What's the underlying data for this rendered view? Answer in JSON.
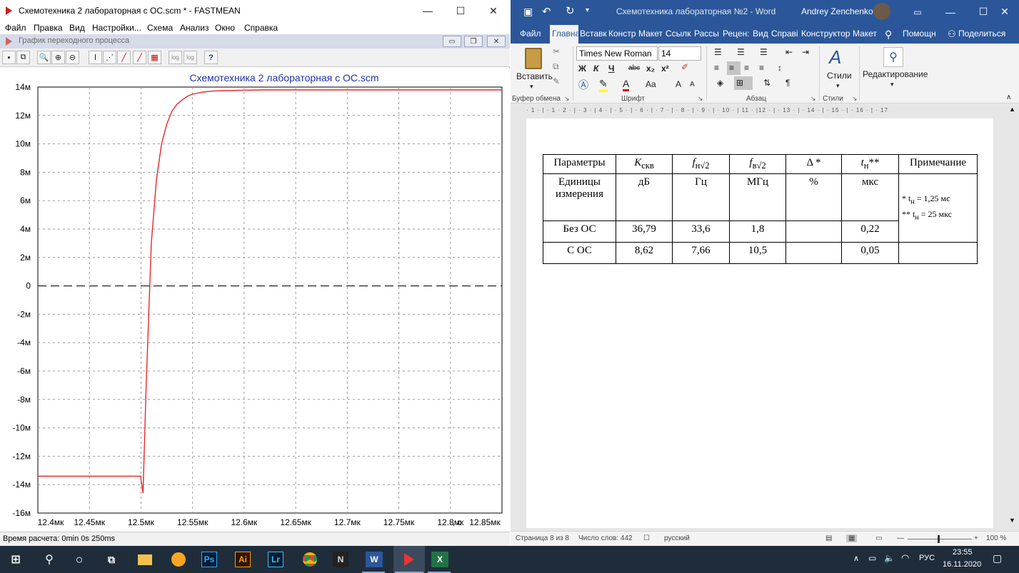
{
  "fastmean": {
    "title": "Схемотехника 2 лабораторная с OC.scm * - FASTMEAN",
    "menu": [
      "Файл",
      "Правка",
      "Вид",
      "Настройки...",
      "Схема",
      "Анализ",
      "Окно",
      "Справка"
    ],
    "child_title": "График переходного процесса",
    "toolbar_icons": [
      "save-icon",
      "copy-icon",
      "zoom-icon",
      "zoom-area-icon",
      "zoom-reset-icon",
      "text-cursor-icon",
      "dots-line-icon",
      "line-icon",
      "red-line-icon",
      "grid-icon",
      "log-x-icon",
      "log-y-icon",
      "help-icon"
    ],
    "log_label": "log",
    "help_label": "?",
    "status": "Время расчета: 0min 0s 250ms"
  },
  "chart_data": {
    "type": "line",
    "title": "Схемотехника 2 лабораторная с OC.scm",
    "xlabel": "с",
    "ylabel": "",
    "xlim": [
      12.4,
      12.85
    ],
    "ylim": [
      -16,
      14
    ],
    "x_ticks": [
      "12.4мк",
      "12.45мк",
      "12.5мк",
      "12.55мк",
      "12.6мк",
      "12.65мк",
      "12.7мк",
      "12.75мк",
      "12.8мк",
      "12.85мк"
    ],
    "y_ticks": [
      "14м",
      "12м",
      "10м",
      "8м",
      "6м",
      "4м",
      "2м",
      "0",
      "-2м",
      "-4м",
      "-6м",
      "-8м",
      "-10м",
      "-12м",
      "-14м",
      "-16м"
    ],
    "grid": true,
    "series": [
      {
        "color": "#e8282b",
        "x": [
          12.4,
          12.5,
          12.5,
          12.502,
          12.505,
          12.51,
          12.515,
          12.52,
          12.525,
          12.53,
          12.535,
          12.54,
          12.545,
          12.55,
          12.56,
          12.57,
          12.58,
          12.6,
          12.62,
          12.65,
          12.85
        ],
        "y": [
          -13.4,
          -13.4,
          -13.6,
          -14.6,
          -7.0,
          3.0,
          7.5,
          10.0,
          11.4,
          12.3,
          12.8,
          13.1,
          13.35,
          13.5,
          13.65,
          13.72,
          13.75,
          13.78,
          13.8,
          13.8,
          13.8
        ]
      }
    ],
    "zero_line": 0
  },
  "word": {
    "title": "Схемотехника лабораторная №2  -  Word",
    "user": "Andrey Zenchenko",
    "tabs": [
      "Файл",
      "Главна",
      "Вставк",
      "Констр",
      "Макет",
      "Ссылкі",
      "Рассы",
      "Рецен:",
      "Вид",
      "Справі",
      "Конструктор",
      "Макет"
    ],
    "help_label": "Помощн",
    "share_label": "Поделиться",
    "font_name": "Times New Roman",
    "font_size": "14",
    "paste_label": "Вставить",
    "styles_label": "Стили",
    "editing_label": "Редактирование",
    "groups": [
      "Буфер обмена",
      "Шрифт",
      "Абзац",
      "Стили"
    ],
    "font_buttons": [
      "Ж",
      "К",
      "Ч",
      "abc",
      "x₂",
      "x²",
      "A",
      "Aa",
      "A",
      "A"
    ],
    "ruler_text": "· 1 · | · 1 · 2 · | · 3 · | 4 · | · 5 · | · 6 · | · 7 · | · 8 · | · 9 · | · 10 · | 11 · |12 · | · 13 · | · 14 · | · 15 · | · 16 · | · 17",
    "table": {
      "headers": [
        "Параметры",
        "K",
        "скв",
        "f",
        "н√2",
        "f",
        "в√2",
        "Δ *",
        "t",
        "н",
        "**",
        "Примечание"
      ],
      "row_units": [
        "Единицы измерения",
        "дБ",
        "Гц",
        "МГц",
        "%",
        "мкс"
      ],
      "row_no_fb": [
        "Без ОС",
        "36,79",
        "33,6",
        "1,8",
        "",
        "0,22"
      ],
      "row_fb": [
        "С ОС",
        "8,62",
        "7,66",
        "10,5",
        "",
        "0,05"
      ],
      "note_line1": "* t",
      "note_line1_sub": "н",
      "note_line1_val": " = 1,25 мс",
      "note_line2": "** t",
      "note_line2_sub": "н",
      "note_line2_val": " = 25 мкс"
    },
    "status": {
      "page": "Страница 8 из 8",
      "words": "Число слов: 442",
      "lang": "русский",
      "zoom": "100 %"
    }
  },
  "taskbar": {
    "lang": "РУС",
    "time": "23:55",
    "date": "16.11.2020",
    "apps": [
      "start-icon",
      "search-icon",
      "cortana-icon",
      "task-view-icon",
      "explorer-icon",
      "chrome-canary-icon",
      "photoshop-icon",
      "illustrator-icon",
      "lightroom-icon",
      "chrome-icon",
      "notion-icon",
      "word-icon",
      "fastmean-icon",
      "excel-icon"
    ],
    "app_labels": [
      "Ps",
      "Ai",
      "Lr",
      "N",
      "W",
      "X"
    ]
  },
  "colors": {
    "word_blue": "#2b579a",
    "plot_line": "#e8282b",
    "plot_title": "#2233aa",
    "taskbar": "#1f2d3b"
  }
}
